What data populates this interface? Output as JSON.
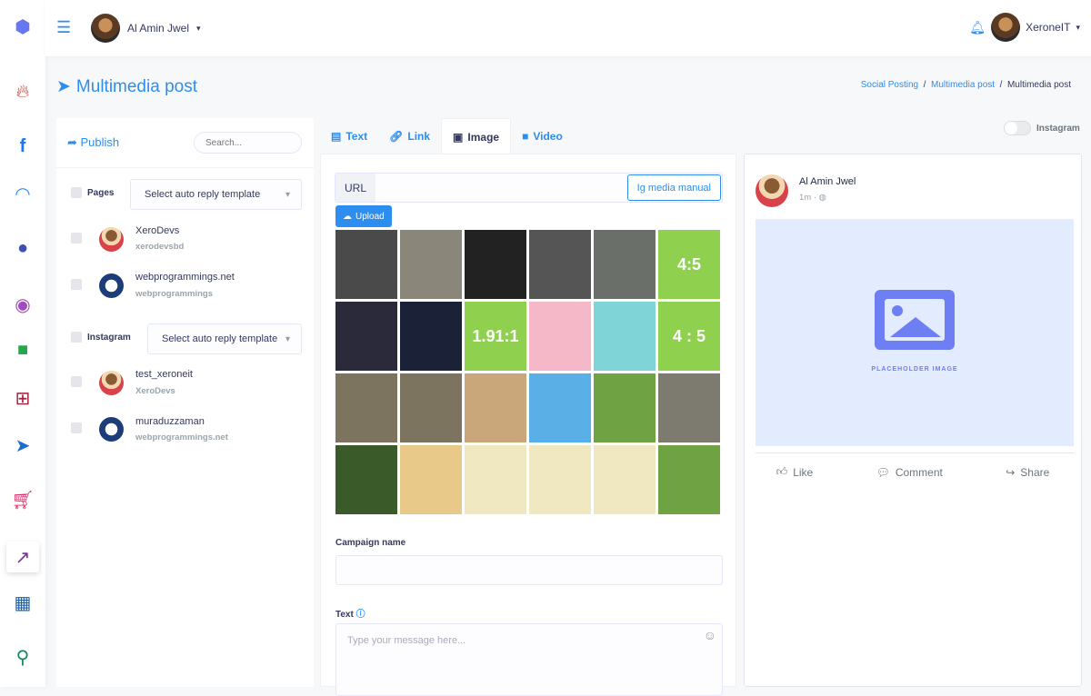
{
  "header": {
    "user_name": "Al Amin Jwel",
    "account_name": "XeroneIT"
  },
  "page": {
    "title": "Multimedia post",
    "breadcrumbs": [
      "Social Posting",
      "Multimedia post",
      "Multimedia post"
    ]
  },
  "left": {
    "publish_label": "Publish",
    "search_placeholder": "Search...",
    "pages_label": "Pages",
    "pages_template": "Select auto reply template",
    "pages": [
      {
        "name": "XeroDevs",
        "sub": "xerodevsbd"
      },
      {
        "name": "webprogrammings.net",
        "sub": "webprogrammings"
      }
    ],
    "instagram_label": "Instagram",
    "instagram_template": "Select auto reply template",
    "instagram": [
      {
        "name": "test_xeroneit",
        "sub": "XeroDevs"
      },
      {
        "name": "muraduzzaman",
        "sub": "webprogrammings.net"
      }
    ]
  },
  "tabs": [
    "Text",
    "Link",
    "Image",
    "Video"
  ],
  "instagram_toggle": {
    "label": "Instagram",
    "on": false
  },
  "image": {
    "url_label": "URL",
    "url_value": "",
    "manual_button": "Ig media manual",
    "upload_button": "Upload",
    "thumbs": [
      "",
      "",
      "",
      "",
      "",
      "4:5",
      "",
      "",
      "1.91:1",
      "",
      "",
      "4 : 5",
      "",
      "",
      "",
      "",
      "",
      "",
      "",
      "",
      "",
      "",
      "",
      ""
    ]
  },
  "form": {
    "campaign_label": "Campaign name",
    "campaign_value": "",
    "text_label": "Text",
    "text_placeholder": "Type your message here..."
  },
  "preview": {
    "name": "Al Amin Jwel",
    "time": "1m",
    "placeholder": "PLACEHOLDER IMAGE",
    "actions": [
      "Like",
      "Comment",
      "Share"
    ]
  }
}
